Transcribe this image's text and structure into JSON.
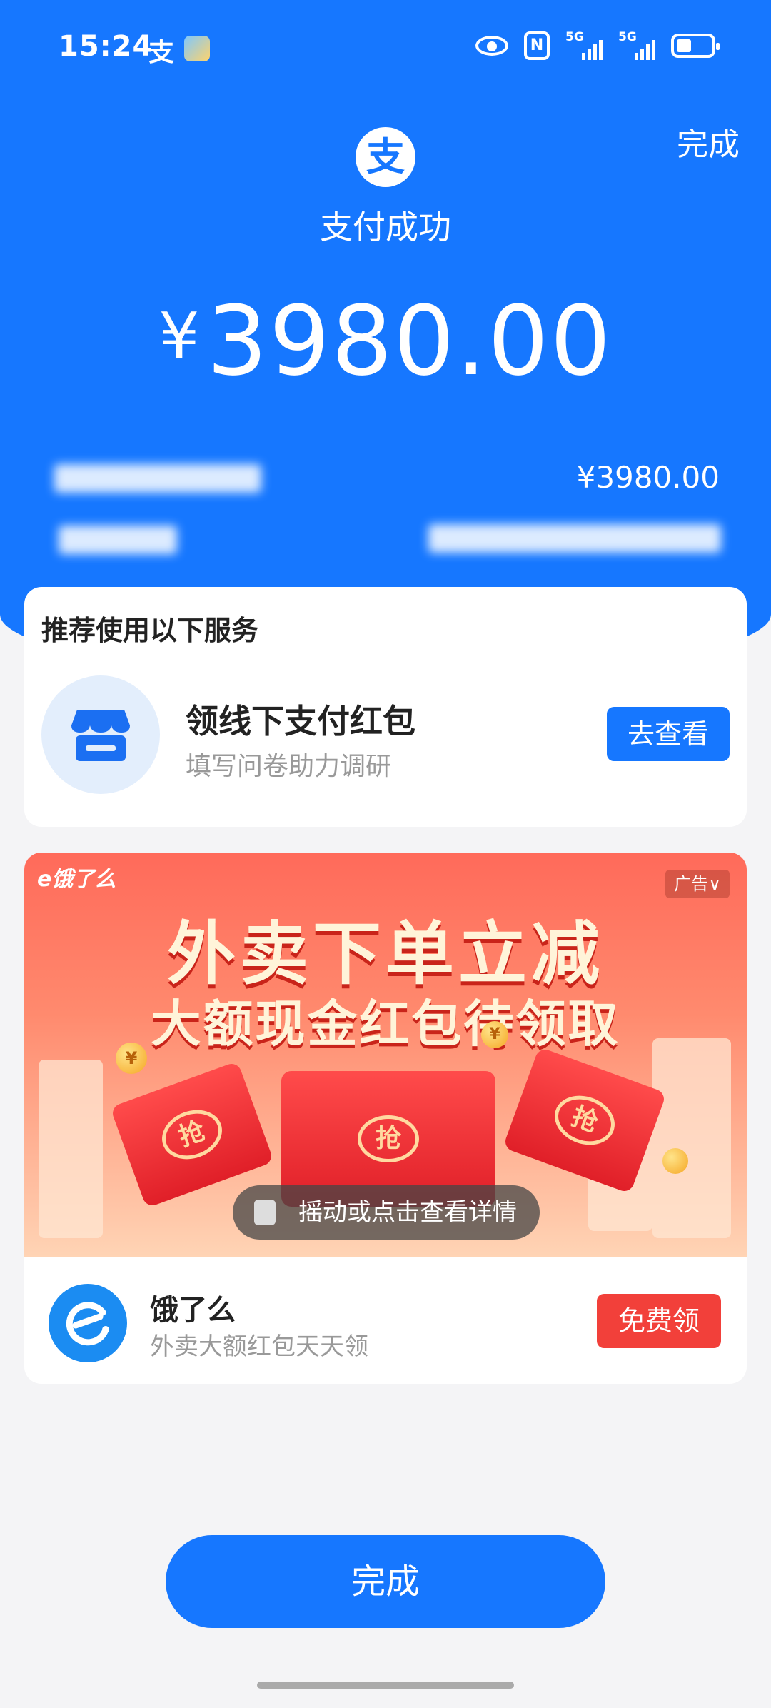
{
  "status_bar": {
    "time": "15:24",
    "alipay_glyph": "支",
    "nfc_label": "N",
    "signal_1": "5G",
    "signal_2": "5G",
    "icons": [
      "alipay-icon",
      "weather-icon",
      "eye-icon",
      "nfc-icon",
      "signal-icon",
      "signal-icon",
      "battery-icon"
    ]
  },
  "header": {
    "done_label": "完成",
    "logo_glyph": "支",
    "title": "支付成功",
    "currency": "¥",
    "amount": "3980.00",
    "detail_amount": "¥3980.00"
  },
  "recommend": {
    "title": "推荐使用以下服务",
    "item_title": "领线下支付红包",
    "item_subtitle": "填写问卷助力调研",
    "button": "去查看",
    "icon": "store-icon"
  },
  "ad": {
    "brand_logo": "e饿了么",
    "tag": "广告∨",
    "headline": "外卖下单立减",
    "subheadline": "大额现金红包待领取",
    "envelope_seal": "抢",
    "coin_symbol": "¥",
    "shake_hint": "摇动或点击查看详情",
    "app_name": "饿了么",
    "app_desc": "外卖大额红包天天领",
    "button": "免费领",
    "colors": {
      "banner_top": "#ff6a5a",
      "button": "#f2403a"
    }
  },
  "footer": {
    "done_label": "完成"
  },
  "colors": {
    "brand_blue": "#1677ff",
    "page_bg": "#f4f4f6"
  }
}
